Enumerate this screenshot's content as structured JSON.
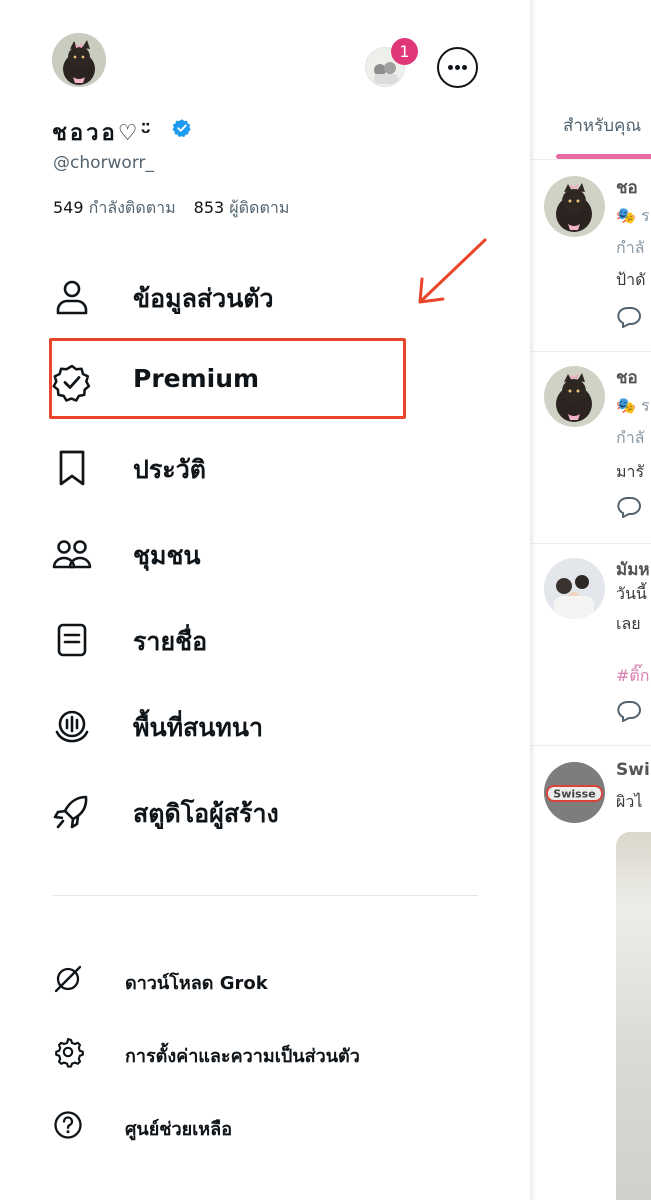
{
  "profile": {
    "display_name": "ชอวอ♡ᵕ̈",
    "handle": "@chorworr_",
    "following_count": "549",
    "following_label": "กำลังติดตาม",
    "followers_count": "853",
    "followers_label": "ผู้ติดตาม",
    "notification_badge": "1",
    "verified_color": "#1d9bf0"
  },
  "nav": [
    {
      "label": "ข้อมูลส่วนตัว",
      "icon": "person-icon"
    },
    {
      "label": "Premium",
      "icon": "verified-badge-icon"
    },
    {
      "label": "ประวัติ",
      "icon": "bookmark-icon"
    },
    {
      "label": "ชุมชน",
      "icon": "communities-icon"
    },
    {
      "label": "รายชื่อ",
      "icon": "lists-icon"
    },
    {
      "label": "พื้นที่สนทนา",
      "icon": "spaces-icon"
    },
    {
      "label": "สตูดิโอผู้สร้าง",
      "icon": "rocket-icon"
    }
  ],
  "secondary": [
    {
      "label": "ดาวน์โหลด Grok",
      "icon": "grok-icon"
    },
    {
      "label": "การตั้งค่าและความเป็นส่วนตัว",
      "icon": "gear-icon"
    },
    {
      "label": "ศูนย์ช่วยเหลือ",
      "icon": "help-icon"
    }
  ],
  "annotation": {
    "color": "#e8452a",
    "highlighted_item": "Premium"
  },
  "feed": {
    "tab": "สำหรับคุณ",
    "accent": "#e76aa2",
    "posts": [
      {
        "name": "ชอ",
        "line1": "🎭 ร",
        "line2": "กำลั",
        "line3": "ป้าดั"
      },
      {
        "name": "ชอ",
        "line1": "🎭 ร",
        "line2": "กำลั",
        "line3": "มารั"
      },
      {
        "name": "มัมห",
        "line1": "วันนี้",
        "line2": "เลย",
        "tag": "#ติ๊ก"
      },
      {
        "name": "Swi",
        "line1": "ผิวไ",
        "brand": "Swisse"
      }
    ]
  }
}
